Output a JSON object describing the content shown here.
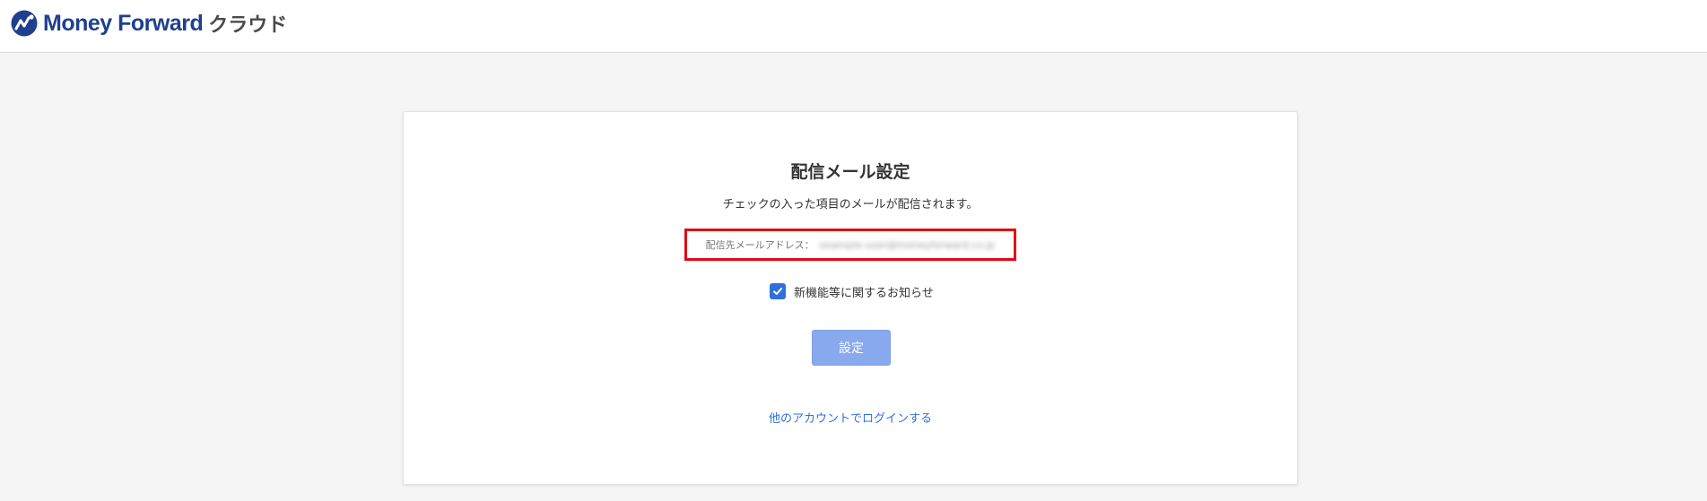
{
  "header": {
    "logo_icon": "money-forward-mark-icon",
    "brand": "Money Forward",
    "suffix": "クラウド"
  },
  "card": {
    "title": "配信メール設定",
    "subtitle": "チェックの入った項目のメールが配信されます。",
    "email_label": "配信先メールアドレス：",
    "email_value": "example-user@moneyforward.co.jp",
    "options": [
      {
        "label": "新機能等に関するお知らせ",
        "checked": true
      }
    ],
    "submit_label": "設定",
    "other_account_link": "他のアカウントでログインする"
  },
  "colors": {
    "brand": "#1f3f8f",
    "accent": "#2f6fe0",
    "button": "#89a9ee",
    "highlight": "#e30613",
    "background": "#f5f5f5"
  }
}
